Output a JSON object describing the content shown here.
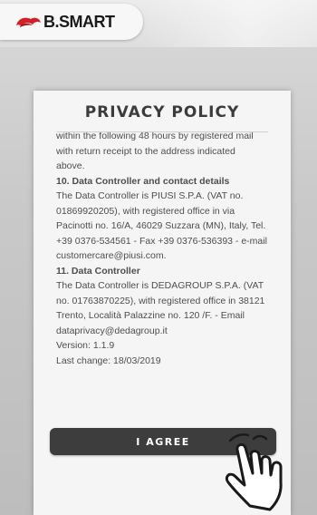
{
  "header": {
    "logo_text": "B.SMART",
    "logo_color": "#d2202a"
  },
  "modal": {
    "title": "PRIVACY POLICY",
    "lines": [
      "within the following 48 hours by registered mail",
      "with return receipt to the address indicated",
      "above.",
      "10. Data Controller and contact details",
      "The Data Controller is PIUSI S.P.A. (VAT no.",
      "01869920205), with registered office in via",
      "Pacinotti no. 16/A, 46029 Suzzara (MN), Italy, Tel.",
      "+39 0376-534561 - Fax +39 0376-536393 - e-mail",
      "customercare@piusi.com.",
      "11. Data Controller",
      "The Data Controller is DEDAGROUP S.P.A. (VAT",
      "no. 01763870225), with registered office in 38121",
      "Trento, Località Palazzine no. 120 /F. - Email",
      "dataprivacy@dedagroup.it",
      "Version: 1.1.9",
      "Last change: 18/03/2019"
    ],
    "agree_label": "I AGREE"
  },
  "icons": {
    "pointer": "hand-pointer-icon",
    "logo": "bsmart-logo-icon"
  }
}
